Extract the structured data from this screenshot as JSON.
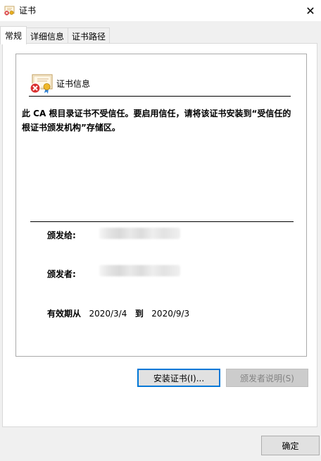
{
  "window": {
    "title": "证书",
    "close_glyph": "✕"
  },
  "tabs": [
    {
      "label": "常规",
      "active": true
    },
    {
      "label": "详细信息",
      "active": false
    },
    {
      "label": "证书路径",
      "active": false
    }
  ],
  "cert_info": {
    "heading": "证书信息",
    "warning": "此 CA 根目录证书不受信任。要启用信任，请将该证书安装到“受信任的根证书颁发机构”存储区。",
    "issued_to_label": "颁发给:",
    "issued_by_label": "颁发者:",
    "validity_label": "有效期从",
    "valid_from": "2020/3/4",
    "to_label": "到",
    "valid_to": "2020/9/3"
  },
  "buttons": {
    "install": "安装证书(I)...",
    "issuer_statement": "颁发者说明(S)",
    "ok": "确定"
  },
  "icons": {
    "title": "certificate-error-icon",
    "cert": "certificate-error-icon",
    "close": "close-icon"
  }
}
